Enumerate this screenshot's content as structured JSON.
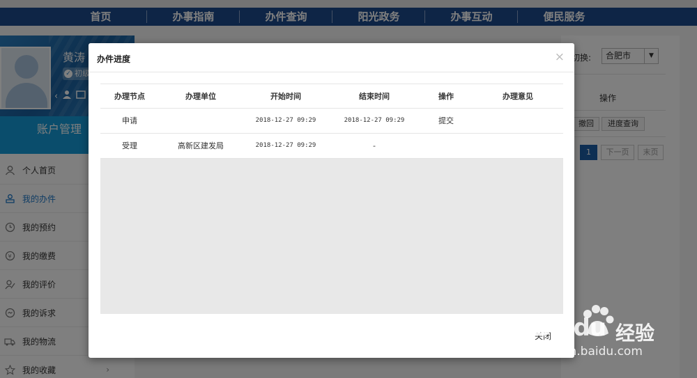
{
  "nav": [
    "首页",
    "办事指南",
    "办件查询",
    "阳光政务",
    "办事互动",
    "便民服务"
  ],
  "profile": {
    "name": "黄涛",
    "badge": "初级"
  },
  "account_title": "账户管理",
  "side_menu": [
    {
      "label": "个人首页",
      "icon": "user-icon",
      "active": false
    },
    {
      "label": "我的办件",
      "icon": "stamp-icon",
      "active": true
    },
    {
      "label": "我的预约",
      "icon": "clock-icon",
      "active": false
    },
    {
      "label": "我的缴费",
      "icon": "payment-icon",
      "active": false
    },
    {
      "label": "我的评价",
      "icon": "rating-icon",
      "active": false
    },
    {
      "label": "我的诉求",
      "icon": "message-icon",
      "active": false
    },
    {
      "label": "我的物流",
      "icon": "truck-icon",
      "active": false
    },
    {
      "label": "我的收藏",
      "icon": "star-icon",
      "active": false
    }
  ],
  "right": {
    "city_label": "切换:",
    "city_value": "合肥市",
    "ops_header": "操作",
    "btn_withdraw": "撤回",
    "btn_progress": "进度查询",
    "page_current": "1",
    "page_next": "下一页",
    "page_last": "末页"
  },
  "modal": {
    "title": "办件进度",
    "close_symbol": "×",
    "columns": [
      "办理节点",
      "办理单位",
      "开始时间",
      "结束时间",
      "操作",
      "办理意见"
    ],
    "rows": [
      [
        "申请",
        "",
        "2018-12-27 09:29",
        "2018-12-27 09:29",
        "提交",
        ""
      ],
      [
        "受理",
        "高新区建发局",
        "2018-12-27 09:29",
        "-",
        "",
        ""
      ]
    ],
    "close_button": "关闭"
  },
  "watermark": {
    "logo": "Baidu",
    "cn": "经验",
    "url": "jingyan.baidu.com"
  }
}
